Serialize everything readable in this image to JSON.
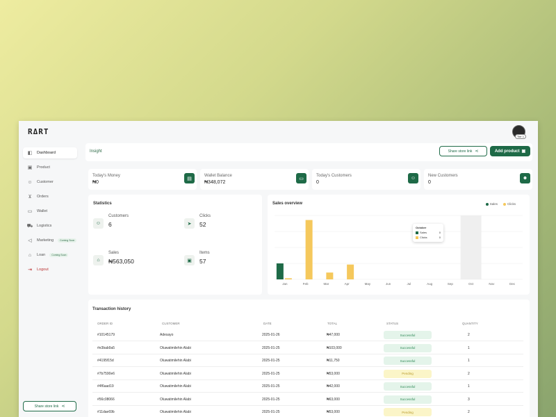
{
  "app": {
    "logo": "RΔRT",
    "avatar_badge": "Tier 1"
  },
  "colors": {
    "brand": "#1e6a47",
    "sales": "#1e6a47",
    "clicks": "#f5c85c",
    "logout": "#b33333"
  },
  "sidebar": {
    "items": [
      {
        "label": "Dashboard",
        "icon": "dashboard-icon",
        "active": true
      },
      {
        "label": "Product",
        "icon": "box-icon"
      },
      {
        "label": "Customer",
        "icon": "users-icon"
      },
      {
        "label": "Orders",
        "icon": "cart-icon"
      },
      {
        "label": "Wallet",
        "icon": "wallet-icon"
      },
      {
        "label": "Logistics",
        "icon": "truck-icon"
      },
      {
        "label": "Marketing",
        "icon": "megaphone-icon",
        "tag": "Coming Soon"
      },
      {
        "label": "Loan",
        "icon": "loan-icon",
        "tag": "Coming Soon"
      },
      {
        "label": "Logout",
        "icon": "logout-icon"
      }
    ],
    "share_label": "Share store link"
  },
  "header": {
    "title": "Insight",
    "share_label": "Share store link",
    "add_label": "Add product"
  },
  "summary_cards": [
    {
      "label": "Today's Money",
      "value": "₦0",
      "icon": "money-icon"
    },
    {
      "label": "Wallet Balance",
      "value": "₦348,072",
      "icon": "wallet-icon"
    },
    {
      "label": "Today's Customers",
      "value": "0",
      "icon": "customer-icon"
    },
    {
      "label": "New Customers",
      "value": "0",
      "icon": "new-customer-icon"
    }
  ],
  "statistics": {
    "title": "Statistics",
    "items": [
      {
        "label": "Customers",
        "value": "6",
        "icon": "users-icon"
      },
      {
        "label": "Clicks",
        "value": "52",
        "icon": "cursor-icon"
      },
      {
        "label": "Sales",
        "value": "₦563,050",
        "icon": "store-icon"
      },
      {
        "label": "Items",
        "value": "57",
        "icon": "box-icon"
      }
    ]
  },
  "sales_overview": {
    "title": "Sales overview",
    "legend": [
      "Sales",
      "Clicks"
    ],
    "tooltip": {
      "month": "October",
      "rows": [
        {
          "label": "Sales",
          "value": "0"
        },
        {
          "label": "Clicks",
          "value": "0"
        }
      ]
    }
  },
  "chart_data": {
    "type": "bar",
    "categories": [
      "Jan",
      "Feb",
      "Mar",
      "Apr",
      "May",
      "Jun",
      "Jul",
      "Aug",
      "Sep",
      "Oct",
      "Nov",
      "Dec"
    ],
    "series": [
      {
        "name": "Sales",
        "values": [
          7,
          0,
          0,
          0,
          0,
          0,
          0,
          0,
          0,
          0,
          0,
          0
        ]
      },
      {
        "name": "Clicks",
        "values": [
          0.5,
          26,
          3,
          6.5,
          0,
          0,
          0,
          0,
          0,
          0,
          0,
          0
        ]
      }
    ],
    "highlight": "Oct",
    "ylim": [
      0,
      28
    ],
    "grid": true
  },
  "transactions": {
    "title": "Transaction history",
    "columns": [
      "ORDER ID",
      "CUSTOMER",
      "DATE",
      "TOTAL",
      "STATUS",
      "QUANTITY"
    ],
    "rows": [
      {
        "id": "#10145179",
        "customer": "Adesayo",
        "date": "2025-01-26",
        "total": "₦47,000",
        "status": "Successful",
        "qty": "2"
      },
      {
        "id": "#e3bab9a5",
        "customer": "Oluwatimilehin Alabi",
        "date": "2025-01-25",
        "total": "₦103,000",
        "status": "Successful",
        "qty": "1"
      },
      {
        "id": "#4195f15d",
        "customer": "Oluwatimilehin Alabi",
        "date": "2025-01-25",
        "total": "₦11,750",
        "status": "Successful",
        "qty": "1"
      },
      {
        "id": "#7b7590e6",
        "customer": "Oluwatimilehin Alabi",
        "date": "2025-01-25",
        "total": "₦53,000",
        "status": "Pending",
        "qty": "2"
      },
      {
        "id": "#4f6aad19",
        "customer": "Oluwatimilehin Alabi",
        "date": "2025-01-25",
        "total": "₦42,000",
        "status": "Successful",
        "qty": "1"
      },
      {
        "id": "#56c08066",
        "customer": "Oluwatimilehin Alabi",
        "date": "2025-01-25",
        "total": "₦63,000",
        "status": "Successful",
        "qty": "3"
      },
      {
        "id": "#11dae69b",
        "customer": "Oluwatimilehin Alabi",
        "date": "2025-01-25",
        "total": "₦53,000",
        "status": "Pending",
        "qty": "2"
      }
    ]
  }
}
